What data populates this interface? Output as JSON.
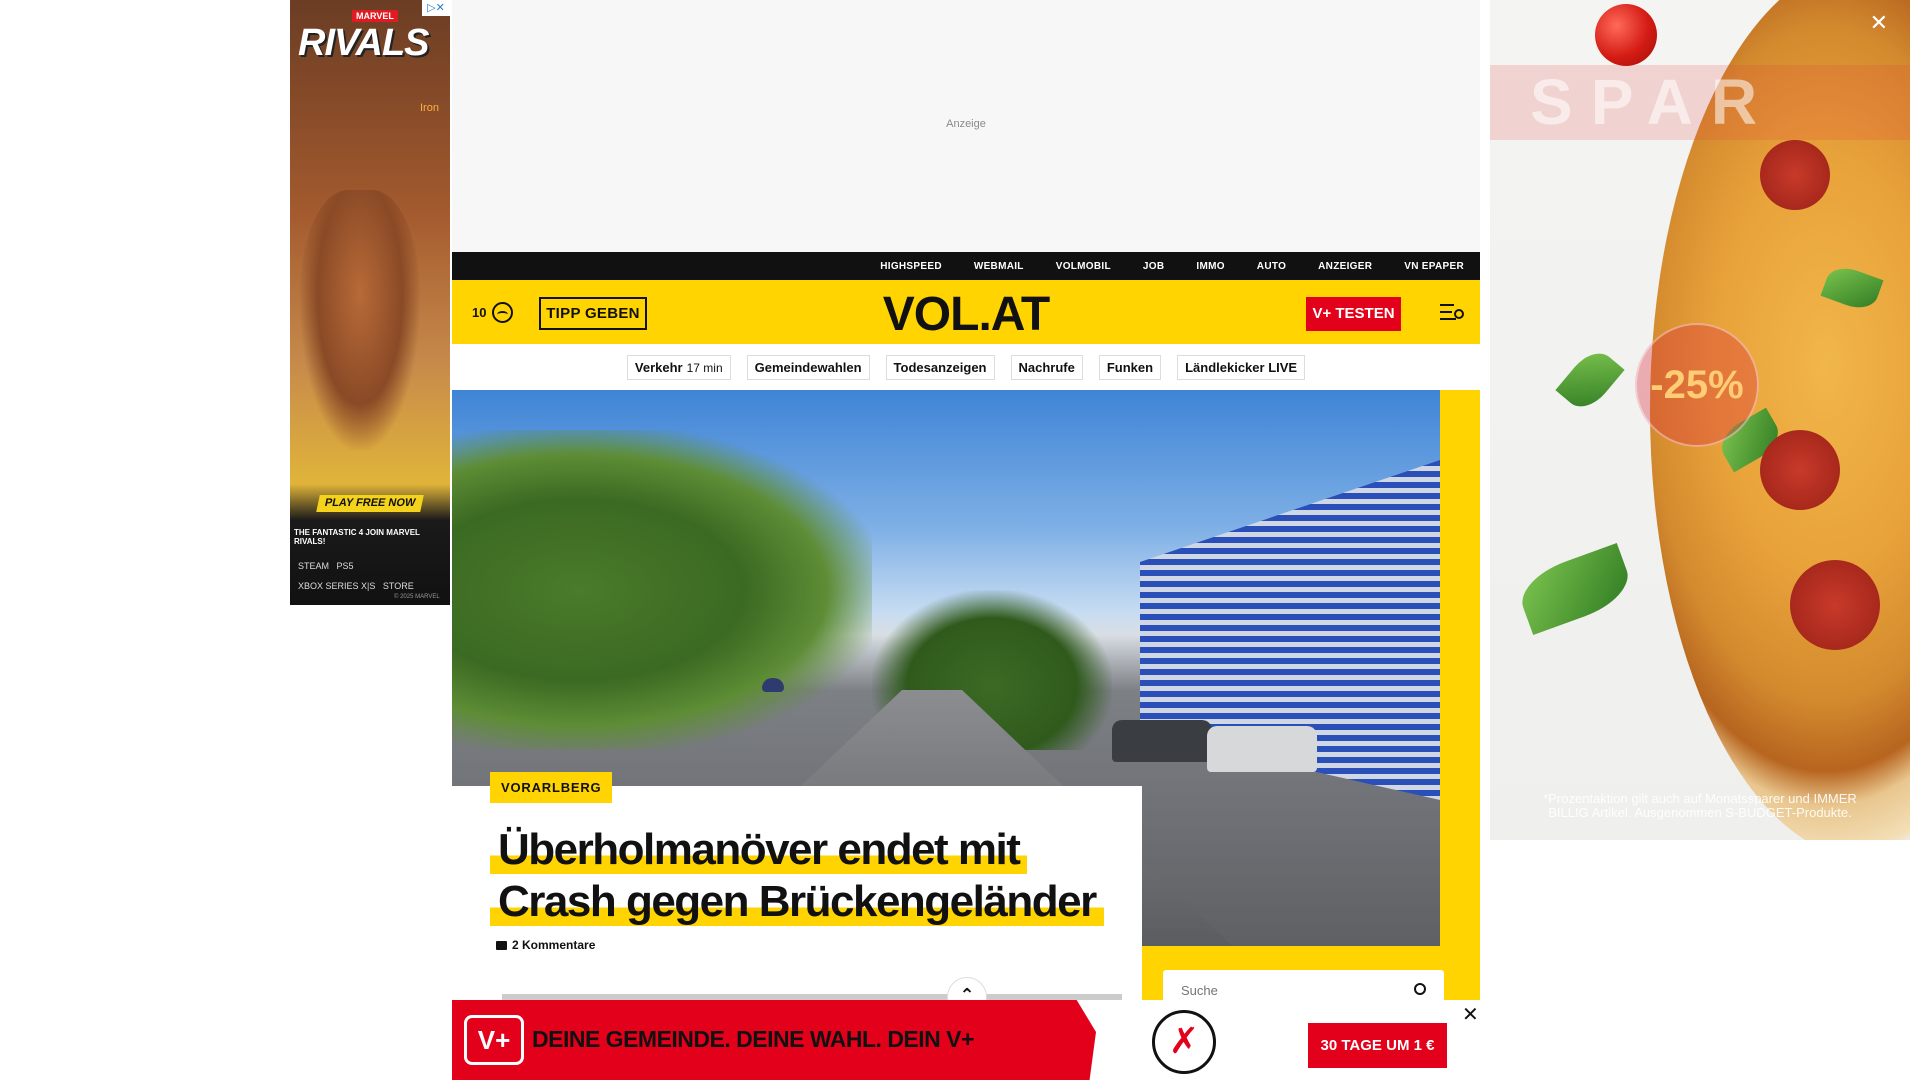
{
  "ads": {
    "left": {
      "brand": "MARVEL",
      "title": "RIVALS",
      "character": "Iron",
      "cta": "PLAY FREE NOW",
      "tagline": "THE FANTASTIC 4 JOIN MARVEL RIVALS!",
      "platforms": [
        "STEAM",
        "PS5",
        "XBOX SERIES X|S",
        "STORE"
      ],
      "copyright": "© 2025 MARVEL",
      "adchoice": "▷✕"
    },
    "top": {
      "label": "Anzeige"
    },
    "right": {
      "brand": "SPAR",
      "discount": "-25%",
      "fineprint": "*Prozentaktion gilt auch auf Monatssparer und IMMER BILLIG Artikel. Ausgenommen S-BUDGET-Produkte.",
      "close": "✕"
    }
  },
  "topbar": {
    "links": [
      "HIGHSPEED",
      "WEBMAIL",
      "VOLMOBIL",
      "JOB",
      "IMMO",
      "AUTO",
      "ANZEIGER",
      "VN EPAPER"
    ]
  },
  "header": {
    "temperature": "10",
    "tip_button": "TIPP GEBEN",
    "logo": "VOL.AT",
    "vplus_button": "V+ TESTEN"
  },
  "quicknav": {
    "traffic_label": "Verkehr",
    "traffic_time": "17 min",
    "items": [
      "Gemeindewahlen",
      "Todesanzeigen",
      "Nachrufe",
      "Funken",
      "Ländlekicker LIVE"
    ]
  },
  "article": {
    "kicker": "VORARLBERG",
    "headline_line1": "Überholmanöver endet mit",
    "headline_line2": "Crash gegen Brückengeländer",
    "comments": "2 Kommentare"
  },
  "search": {
    "placeholder": "Suche"
  },
  "banner": {
    "logo": "V+",
    "slogan": "DEINE GEMEINDE. DEINE WAHL. DEIN V+",
    "cta": "30 TAGE UM 1 €",
    "close": "✕"
  },
  "colors": {
    "brand_yellow": "#ffd400",
    "brand_red": "#e3001b",
    "topbar": "#111111"
  }
}
